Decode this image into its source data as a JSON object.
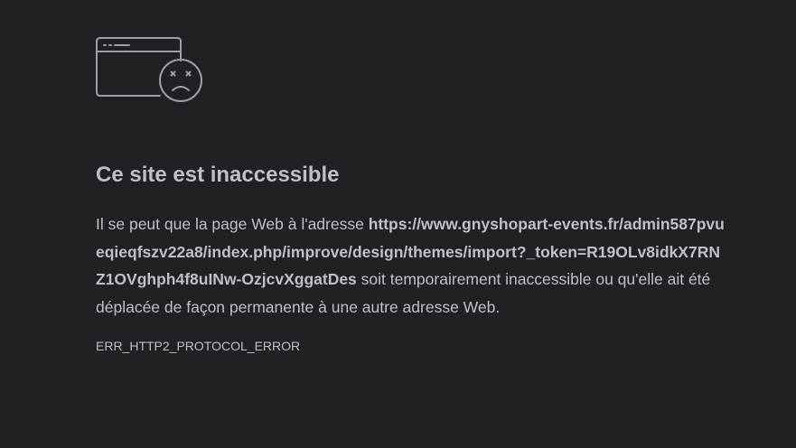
{
  "error_page": {
    "icon": "sad-browser-window-icon",
    "title": "Ce site est inaccessible",
    "message_prefix": "Il se peut que la page Web à l'adresse ",
    "url": "https://www.gnyshopart-events.fr/admin587pvueqieqfszv22a8/index.php/improve/design/themes/import?_token=R19OLv8idkX7RNZ1OVghph4f8uINw-OzjcvXggatDes",
    "message_suffix": " soit temporairement inaccessible ou qu'elle ait été déplacée de façon permanente à une autre adresse Web.",
    "error_code": "ERR_HTTP2_PROTOCOL_ERROR"
  },
  "colors": {
    "background": "#202124",
    "text": "#bdc1c6",
    "icon_stroke": "#9aa0a6"
  }
}
